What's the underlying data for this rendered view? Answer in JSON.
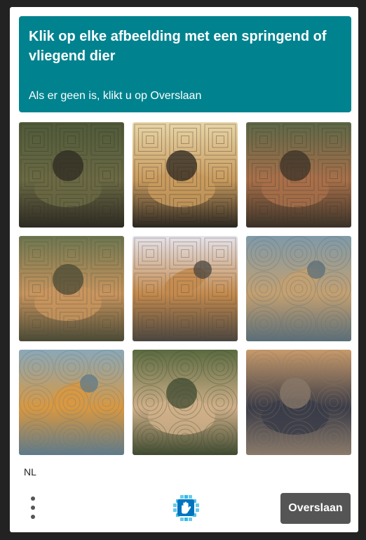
{
  "challenge": {
    "title": "Klik op elke afbeelding met een springend of vliegend dier",
    "subtitle": "Als er geen is, klikt u op Overslaan"
  },
  "images": [
    {
      "subject": "lion-lying",
      "pattern": "squares",
      "colors": [
        "#4f5a3a",
        "#6b6a44",
        "#2d2a22"
      ]
    },
    {
      "subject": "lion-silhouette",
      "pattern": "squares",
      "colors": [
        "#e8d6a8",
        "#c99b5e",
        "#2a2620"
      ]
    },
    {
      "subject": "lion-flowers",
      "pattern": "squares",
      "colors": [
        "#5c6848",
        "#a8704a",
        "#3a3228"
      ]
    },
    {
      "subject": "lioness-lying",
      "pattern": "squares",
      "colors": [
        "#6d7650",
        "#c9955e",
        "#4a4a36"
      ]
    },
    {
      "subject": "lion-leaping",
      "pattern": "squares",
      "colors": [
        "#e6e4ec",
        "#c48a4c",
        "#4a4640"
      ]
    },
    {
      "subject": "lion-jumping-water",
      "pattern": "circles",
      "colors": [
        "#7f9aa8",
        "#c4a070",
        "#5a6e78"
      ]
    },
    {
      "subject": "lion-jumping-water-2",
      "pattern": "circles",
      "colors": [
        "#8aa8b8",
        "#d99840",
        "#5e7a8a"
      ]
    },
    {
      "subject": "lioness-resting",
      "pattern": "circles",
      "colors": [
        "#5a6a40",
        "#d0b08a",
        "#3e4a30"
      ]
    },
    {
      "subject": "black-panther",
      "pattern": "circles",
      "colors": [
        "#c89a6a",
        "#3a3c48",
        "#8a7a6a"
      ]
    }
  ],
  "footer": {
    "language": "NL",
    "skip_label": "Overslaan",
    "menu_icon": "three-dots-vertical-icon",
    "logo_icon": "hcaptcha-logo-icon"
  },
  "colors": {
    "header_bg": "#00838f",
    "skip_bg": "#555555",
    "page_bg": "#222222"
  }
}
